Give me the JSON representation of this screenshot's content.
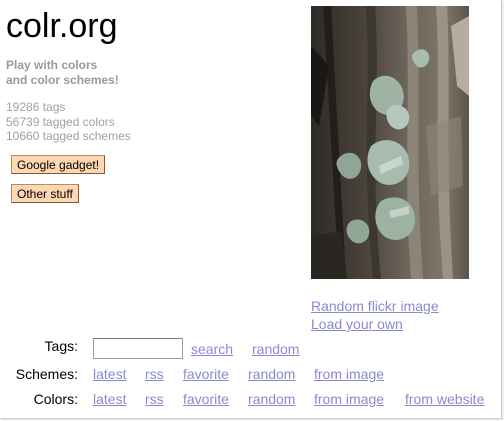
{
  "header": {
    "site_title": "colr.org",
    "tagline_line1": "Play with colors",
    "tagline_line2": "and color schemes!"
  },
  "stats": {
    "tags": "19286 tags",
    "colors": "56739 tagged colors",
    "schemes": "10660 tagged schemes"
  },
  "buttons": {
    "google_gadget": "Google gadget!",
    "other_stuff": "Other stuff"
  },
  "photo_links": {
    "random_flickr": "Random flickr image",
    "load_own": "Load your own"
  },
  "tags_row": {
    "label": "Tags:",
    "input_value": "",
    "search": "search",
    "random": "random"
  },
  "schemes_row": {
    "label": "Schemes:",
    "latest": "latest",
    "rss": "rss",
    "favorite": "favorite",
    "random": "random",
    "from_image": "from image"
  },
  "colors_row": {
    "label": "Colors:",
    "latest": "latest",
    "rss": "rss",
    "favorite": "favorite",
    "random": "random",
    "from_image": "from image",
    "from_website": "from website"
  },
  "colors": {
    "link": "#8a8ad0",
    "muted_text": "#9a9a9a",
    "button_bg": "#fcd7b0"
  },
  "icons": {
    "photo": "tree-bark-lichen-photo"
  }
}
